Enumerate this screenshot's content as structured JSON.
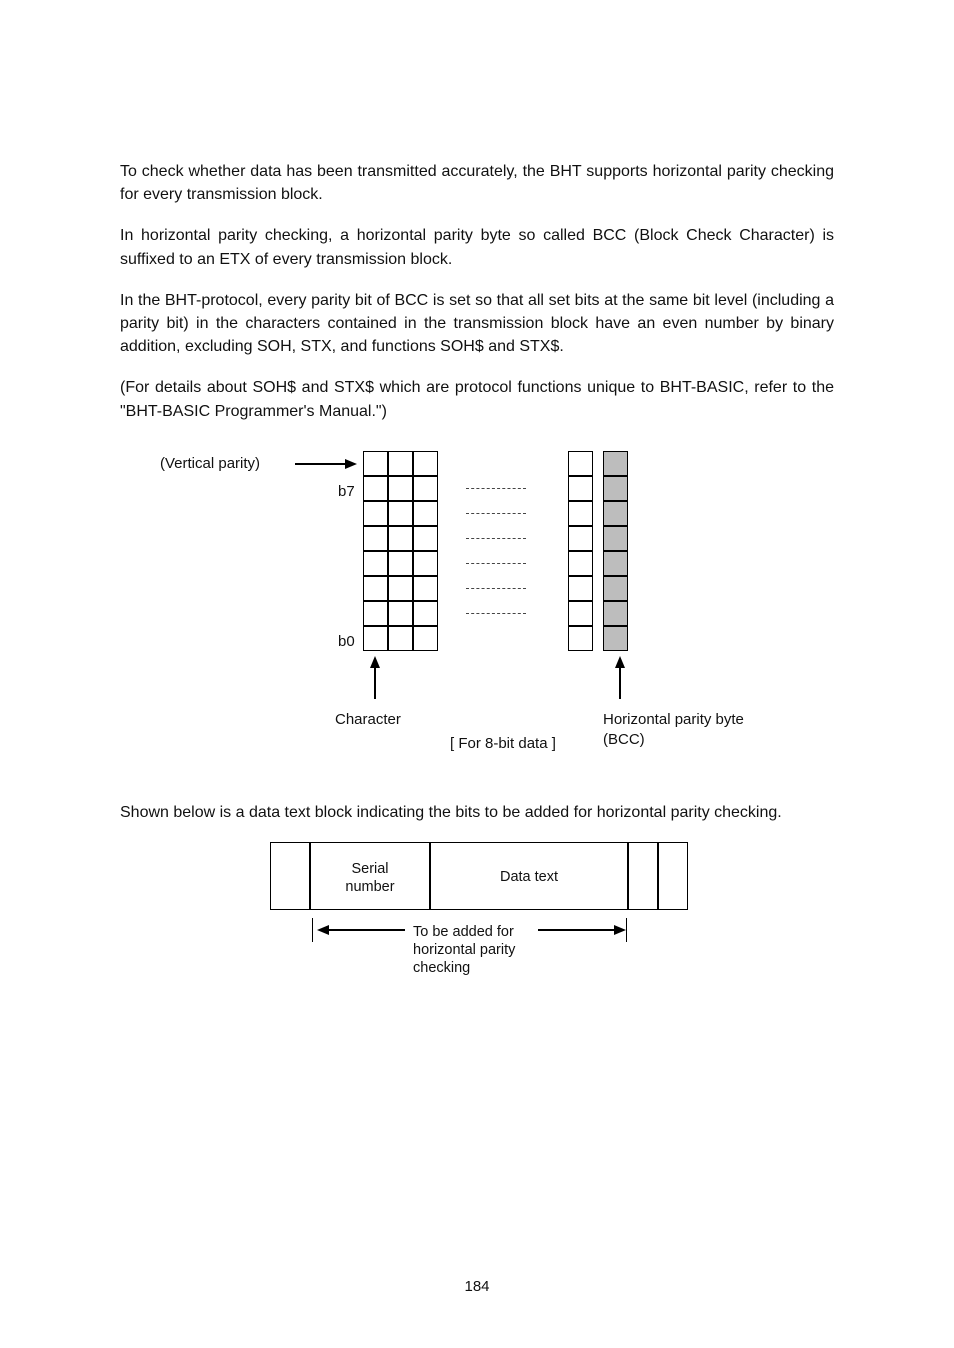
{
  "paragraphs": {
    "p1": "To check whether data has been transmitted accurately, the BHT supports horizontal parity checking for every transmission block.",
    "p2": "In horizontal parity checking, a horizontal parity byte so called BCC (Block Check Character) is suffixed to an ETX of every transmission block.",
    "p3": "In the BHT-protocol, every parity bit of BCC is set so that all set bits at the same bit level (including a parity bit) in the characters contained in the transmission block have an even number by binary addition, excluding SOH, STX, and functions SOH$ and STX$.",
    "p4": "(For details about SOH$ and STX$ which are protocol functions unique to BHT-BASIC, refer to the \"BHT-BASIC Programmer's Manual.\")",
    "p5": "Shown below is a data text block indicating the bits to be added for horizontal parity checking."
  },
  "fig1": {
    "vertical_parity": "(Vertical parity)",
    "b7": "b7",
    "b0": "b0",
    "character": "Character",
    "for8": "[ For 8-bit data ]",
    "hparity1": "Horizontal parity byte",
    "hparity2": "(BCC)"
  },
  "fig2": {
    "serial1": "Serial",
    "serial2": "number",
    "datatext": "Data text",
    "tobe1": "To be added for",
    "tobe2": "horizontal parity",
    "tobe3": "checking"
  },
  "page_number": "184"
}
